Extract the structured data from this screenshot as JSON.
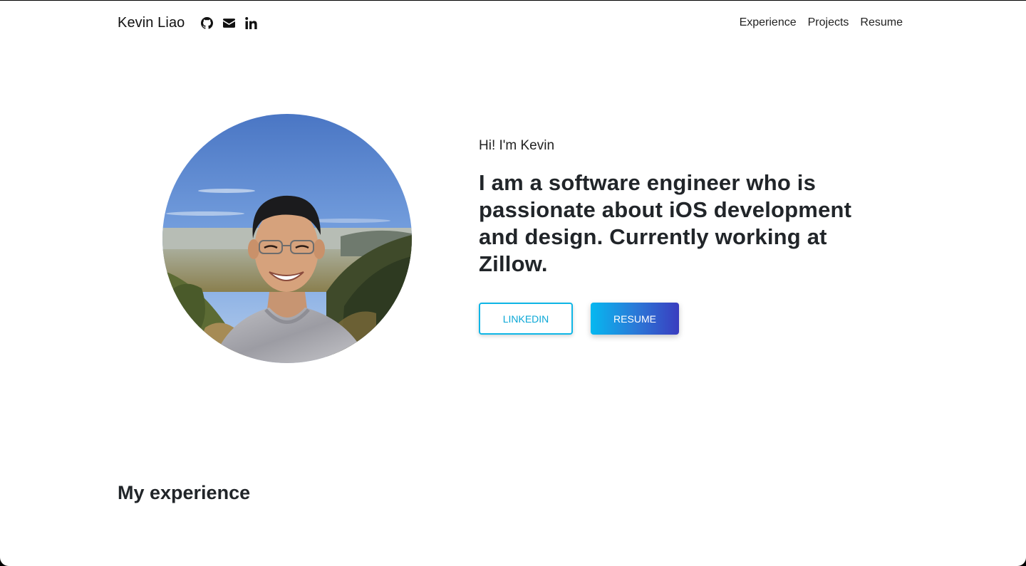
{
  "nav": {
    "brand": "Kevin Liao",
    "social_icons": [
      "github-icon",
      "envelope-icon",
      "linkedin-icon"
    ],
    "links": [
      "Experience",
      "Projects",
      "Resume"
    ]
  },
  "hero": {
    "greeting": "Hi! I'm Kevin",
    "headline": "I am a software engineer who is passionate about iOS development and design. Currently working at Zillow.",
    "buttons": {
      "linkedin": "LINKEDIN",
      "resume": "RESUME"
    }
  },
  "experience": {
    "title": "My experience"
  },
  "colors": {
    "accent": "#0fb6e6",
    "gradient_start": "#06b8f0",
    "gradient_end": "#3a3dbf",
    "text": "#212529"
  }
}
